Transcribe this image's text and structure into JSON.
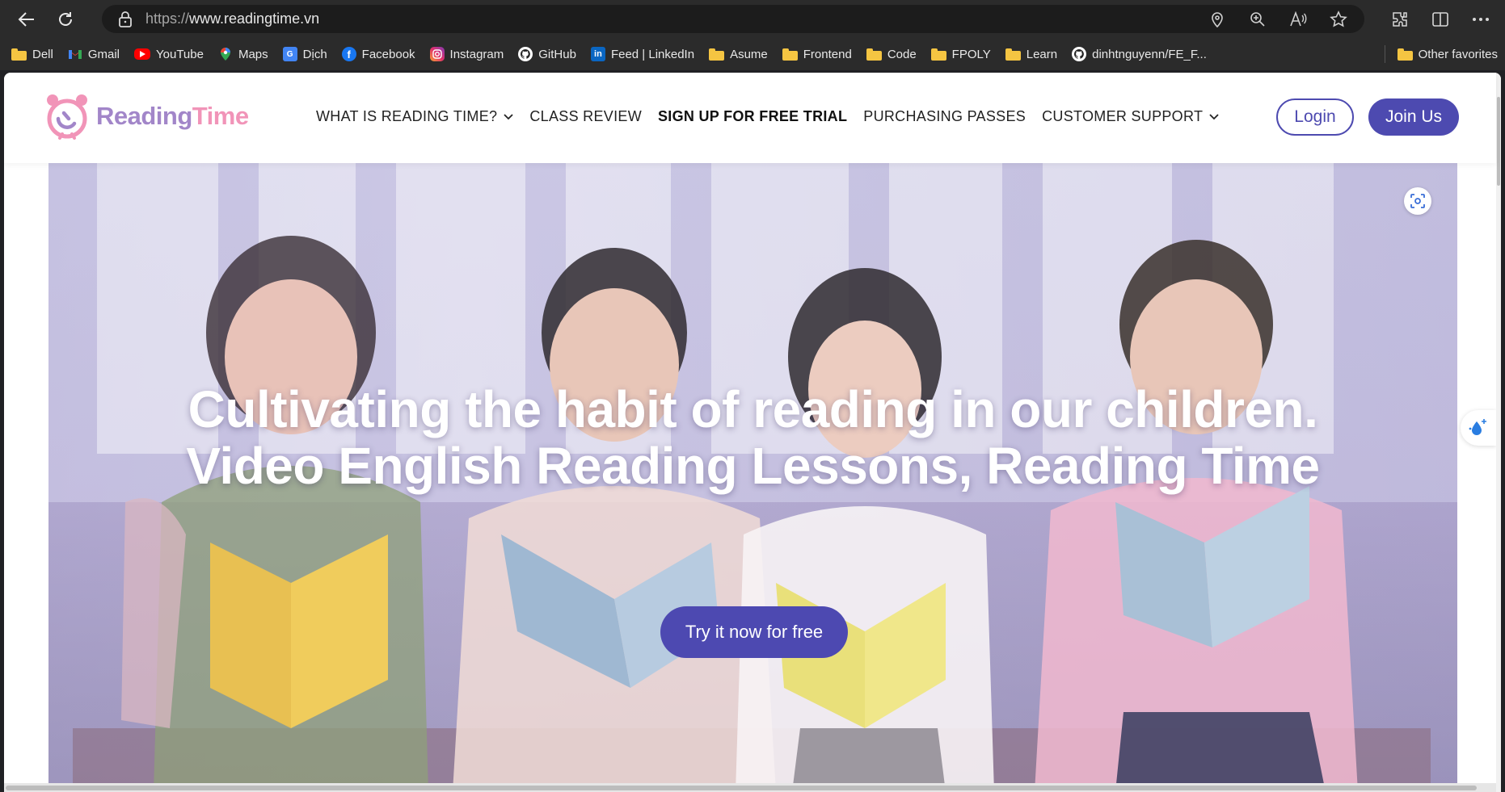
{
  "browser": {
    "url_scheme": "https://",
    "url_host": "www.readingtime.vn",
    "bookmarks": [
      {
        "label": "Dell",
        "icon": "folder-icon"
      },
      {
        "label": "Gmail",
        "icon": "gmail-icon"
      },
      {
        "label": "YouTube",
        "icon": "youtube-icon"
      },
      {
        "label": "Maps",
        "icon": "maps-icon"
      },
      {
        "label": "Dịch",
        "icon": "translate-icon"
      },
      {
        "label": "Facebook",
        "icon": "facebook-icon"
      },
      {
        "label": "Instagram",
        "icon": "instagram-icon"
      },
      {
        "label": "GitHub",
        "icon": "github-icon"
      },
      {
        "label": "Feed | LinkedIn",
        "icon": "linkedin-icon"
      },
      {
        "label": "Asume",
        "icon": "folder-icon"
      },
      {
        "label": "Frontend",
        "icon": "folder-icon"
      },
      {
        "label": "Code",
        "icon": "folder-icon"
      },
      {
        "label": "FPOLY",
        "icon": "folder-icon"
      },
      {
        "label": "Learn",
        "icon": "folder-icon"
      },
      {
        "label": "dinhtnguyenn/FE_F...",
        "icon": "github-icon"
      }
    ],
    "other_favorites": "Other favorites"
  },
  "site": {
    "logo_reading": "Reading",
    "logo_time": "Time",
    "nav": [
      {
        "label": "WHAT IS READING TIME?",
        "has_dropdown": true,
        "bold": false
      },
      {
        "label": "CLASS REVIEW",
        "has_dropdown": false,
        "bold": false
      },
      {
        "label": "SIGN UP FOR FREE TRIAL",
        "has_dropdown": false,
        "bold": true
      },
      {
        "label": "PURCHASING PASSES",
        "has_dropdown": false,
        "bold": false
      },
      {
        "label": "CUSTOMER SUPPORT",
        "has_dropdown": true,
        "bold": false
      }
    ],
    "login_label": "Login",
    "join_label": "Join Us"
  },
  "hero": {
    "title_line1": "Cultivating the habit of reading in our children.",
    "title_line2": "Video English Reading Lessons, Reading Time",
    "cta_label": "Try it now for free"
  },
  "colors": {
    "brand_primary": "#4d4ab0",
    "logo_purple": "#a286c9",
    "logo_pink": "#f194b8"
  }
}
